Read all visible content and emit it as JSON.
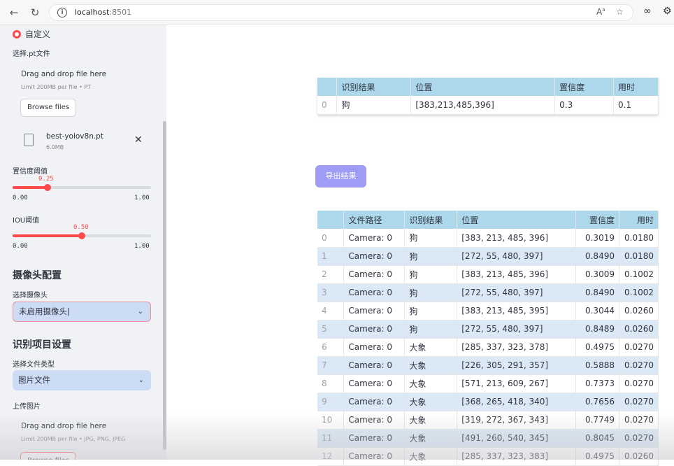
{
  "browser": {
    "url_host": "localhost",
    "url_port": ":8501"
  },
  "sidebar": {
    "radio_label": "自定义",
    "pt_upload": {
      "label": "选择.pt文件",
      "drop_text": "Drag and drop file here",
      "limit_text": "Limit 200MB per file • PT",
      "browse_label": "Browse files",
      "file_name": "best-yolov8n.pt",
      "file_size": "6.0MB"
    },
    "conf_slider": {
      "label": "置信度阈值",
      "value": 0.25,
      "display": "0.25",
      "min": "0.00",
      "max": "1.00"
    },
    "iou_slider": {
      "label": "IOU阈值",
      "value": 0.5,
      "display": "0.50",
      "min": "0.00",
      "max": "1.00"
    },
    "camera_section": {
      "title": "摄像头配置",
      "select_label": "选择摄像头",
      "select_value": "未启用摄像头"
    },
    "recog_section": {
      "title": "识别项目设置",
      "file_type_label": "选择文件类型",
      "file_type_value": "图片文件",
      "upload_label": "上传图片",
      "drop_text": "Drag and drop file here",
      "limit_text": "Limit 200MB per file • JPG, PNG, JPEG",
      "browse_label": "Browse files"
    }
  },
  "main": {
    "result_table": {
      "headers": [
        "",
        "识别结果",
        "位置",
        "置信度",
        "用时"
      ],
      "rows": [
        [
          "0",
          "狗",
          "[383,213,485,396]",
          "0.3",
          "0.1"
        ]
      ]
    },
    "export_label": "导出结果",
    "history_table": {
      "headers": [
        "",
        "文件路径",
        "识别结果",
        "位置",
        "置信度",
        "用时"
      ],
      "rows": [
        [
          "0",
          "Camera: 0",
          "狗",
          "[383, 213, 485, 396]",
          "0.3019",
          "0.0180"
        ],
        [
          "1",
          "Camera: 0",
          "狗",
          "[272, 55, 480, 397]",
          "0.8490",
          "0.0180"
        ],
        [
          "2",
          "Camera: 0",
          "狗",
          "[383, 213, 485, 396]",
          "0.3009",
          "0.1002"
        ],
        [
          "3",
          "Camera: 0",
          "狗",
          "[272, 55, 480, 397]",
          "0.8490",
          "0.1002"
        ],
        [
          "4",
          "Camera: 0",
          "狗",
          "[383, 213, 485, 395]",
          "0.3044",
          "0.0260"
        ],
        [
          "5",
          "Camera: 0",
          "狗",
          "[272, 55, 480, 397]",
          "0.8489",
          "0.0260"
        ],
        [
          "6",
          "Camera: 0",
          "大象",
          "[285, 337, 323, 378]",
          "0.4975",
          "0.0270"
        ],
        [
          "7",
          "Camera: 0",
          "大象",
          "[226, 305, 291, 357]",
          "0.5888",
          "0.0270"
        ],
        [
          "8",
          "Camera: 0",
          "大象",
          "[571, 213, 609, 267]",
          "0.7373",
          "0.0270"
        ],
        [
          "9",
          "Camera: 0",
          "大象",
          "[368, 265, 418, 340]",
          "0.7656",
          "0.0270"
        ],
        [
          "10",
          "Camera: 0",
          "大象",
          "[319, 272, 367, 343]",
          "0.7749",
          "0.0270"
        ],
        [
          "11",
          "Camera: 0",
          "大象",
          "[491, 260, 540, 345]",
          "0.8045",
          "0.0270"
        ],
        [
          "12",
          "Camera: 0",
          "大象",
          "[285, 337, 323, 383]",
          "0.4975",
          "0.0260"
        ]
      ]
    }
  }
}
